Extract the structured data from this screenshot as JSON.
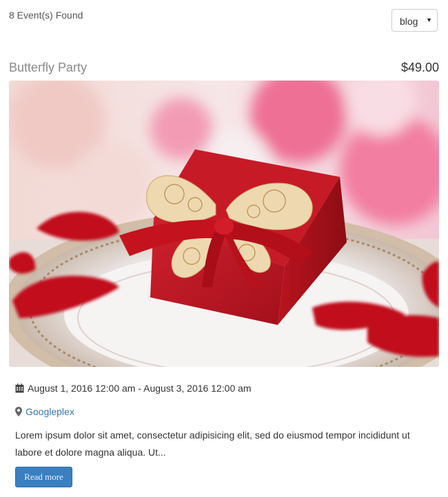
{
  "results": {
    "count_text": "8 Event(s) Found"
  },
  "view_select": {
    "selected": "blog"
  },
  "event": {
    "title": "Butterfly Party",
    "price": "$49.00",
    "image_icon": "gift-box-photo",
    "date_range": "August 1, 2016 12:00 am - August 3, 2016 12:00 am",
    "location": "Googleplex",
    "description": "Lorem ipsum dolor sit amet, consectetur adipisicing elit, sed do eiusmod tempor incididunt ut labore et dolore magna aliqua. Ut...",
    "read_more_label": "Read more"
  },
  "colors": {
    "link": "#337ab7",
    "button": "#3a7fc0",
    "title": "#8a8a8a"
  }
}
